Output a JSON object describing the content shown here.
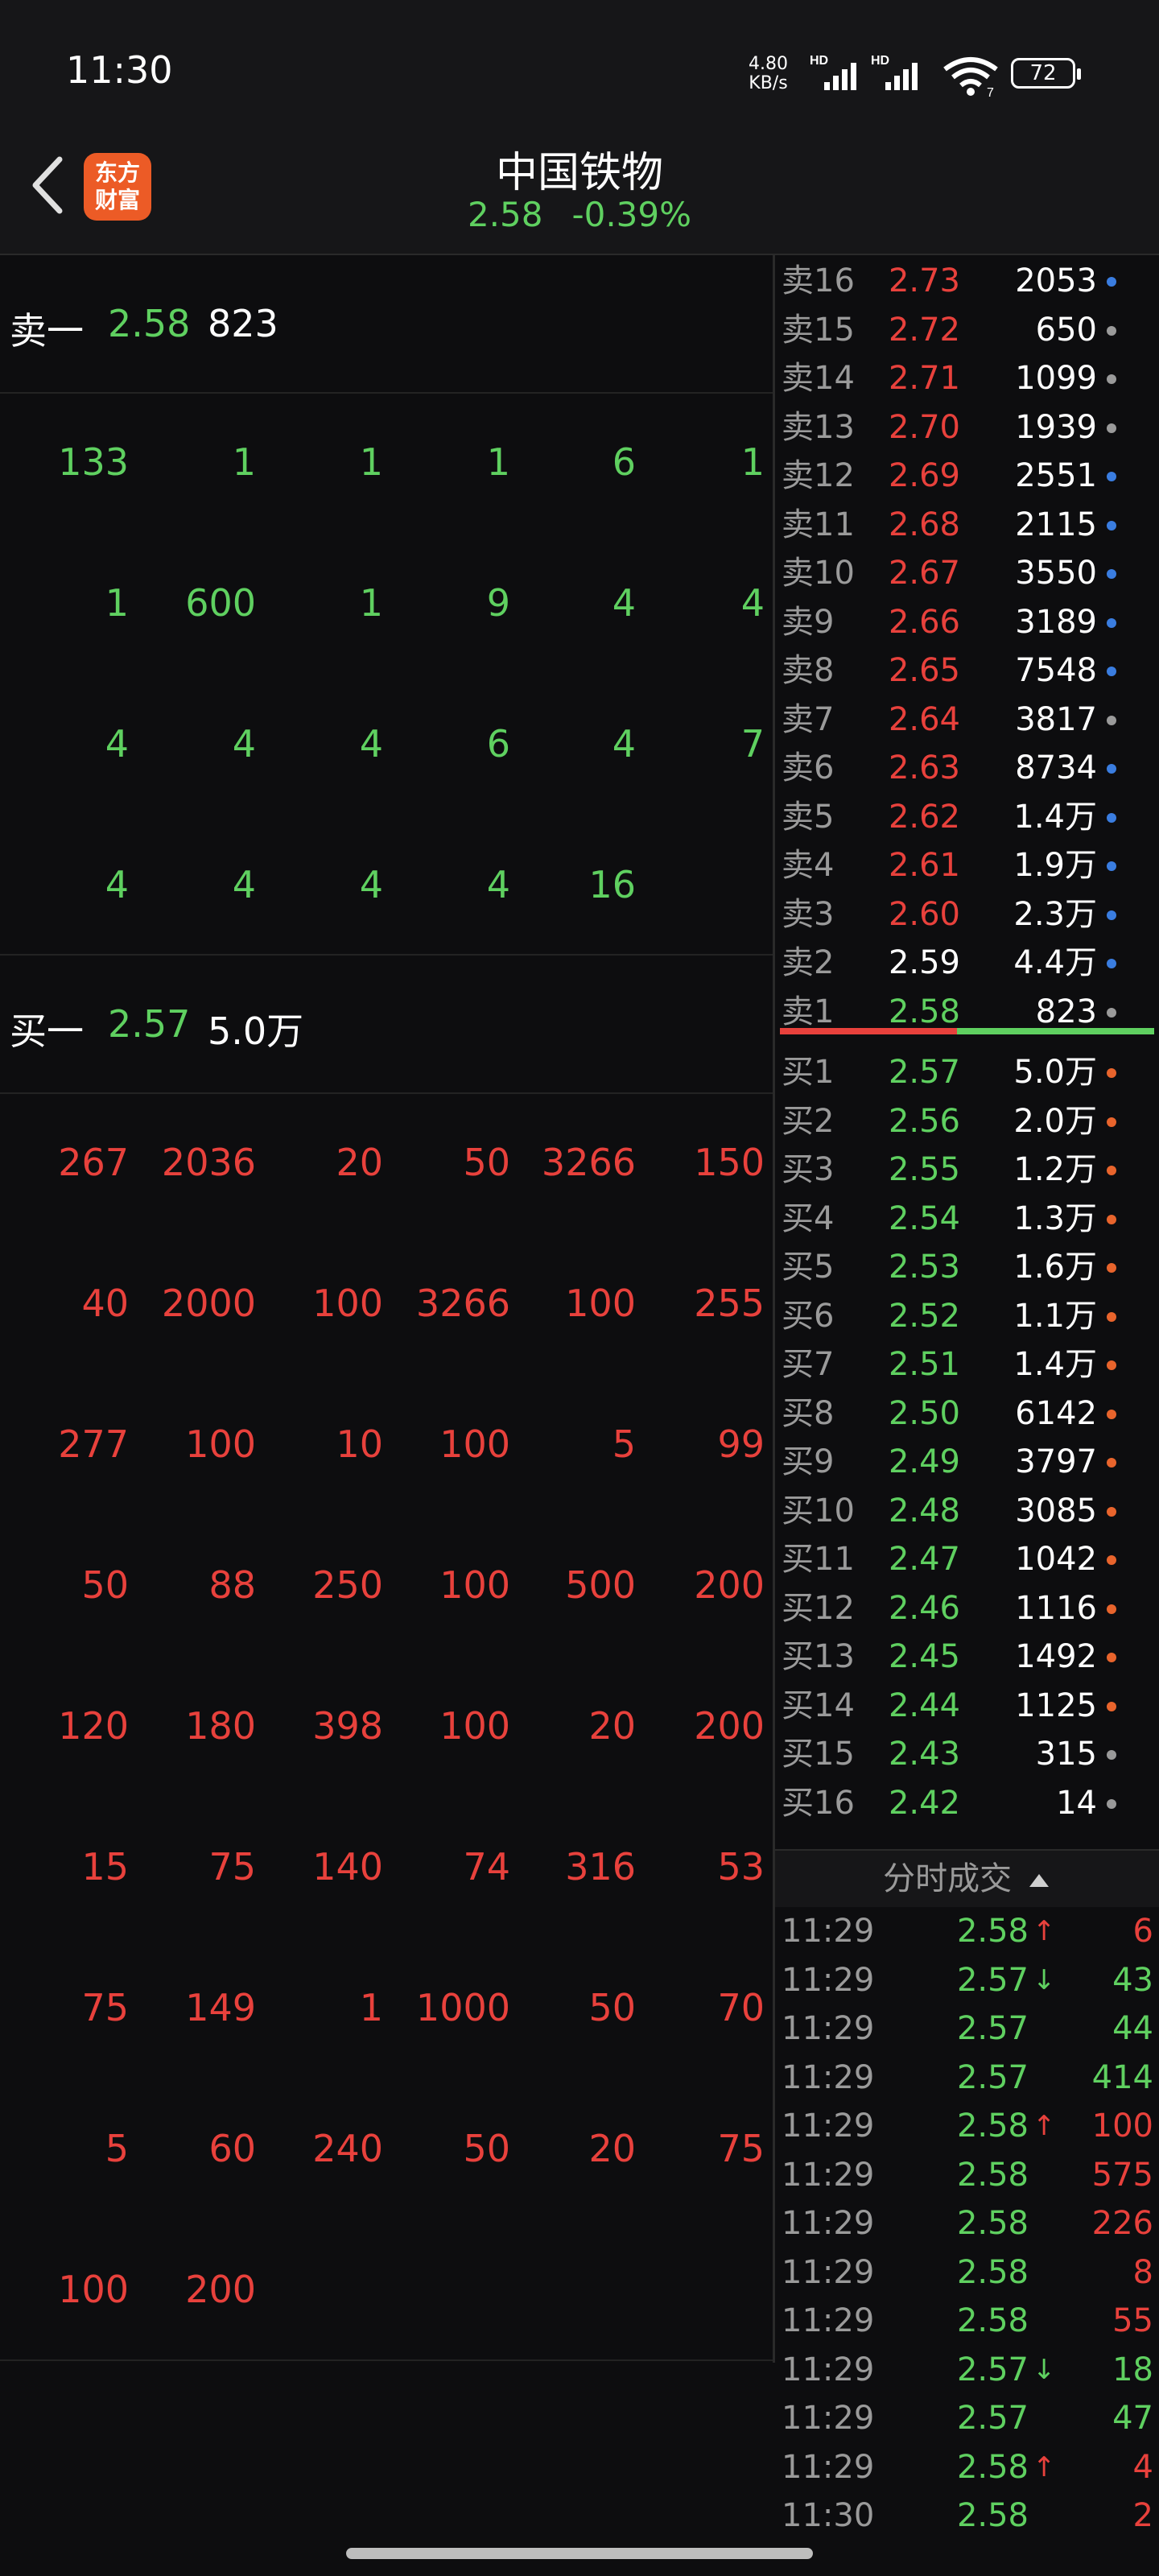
{
  "status_bar": {
    "time": "11:30",
    "net_speed_value": "4.80",
    "net_speed_unit": "KB/s",
    "sig1": "HD",
    "sig2": "HD",
    "wifi_sub": "7",
    "battery": "72"
  },
  "header": {
    "title": "中国铁物",
    "price": "2.58",
    "change": "-0.39%",
    "logo_line1": "东方",
    "logo_line2": "财富"
  },
  "sell_best": {
    "label": "卖一",
    "price": "2.58",
    "volume": "823"
  },
  "sell_queue": [
    [
      "133",
      "1",
      "1",
      "1",
      "6",
      "1"
    ],
    [
      "1",
      "600",
      "1",
      "9",
      "4",
      "4"
    ],
    [
      "4",
      "4",
      "4",
      "6",
      "4",
      "7"
    ],
    [
      "4",
      "4",
      "4",
      "4",
      "16",
      ""
    ]
  ],
  "buy_best": {
    "label": "买一",
    "price": "2.57",
    "volume": "5.0万"
  },
  "buy_queue": [
    [
      "267",
      "2036",
      "20",
      "50",
      "3266",
      "150"
    ],
    [
      "40",
      "2000",
      "100",
      "3266",
      "100",
      "255"
    ],
    [
      "277",
      "100",
      "10",
      "100",
      "5",
      "99"
    ],
    [
      "50",
      "88",
      "250",
      "100",
      "500",
      "200"
    ],
    [
      "120",
      "180",
      "398",
      "100",
      "20",
      "200"
    ],
    [
      "15",
      "75",
      "140",
      "74",
      "316",
      "53"
    ],
    [
      "75",
      "149",
      "1",
      "1000",
      "50",
      "70"
    ],
    [
      "5",
      "60",
      "240",
      "50",
      "20",
      "75"
    ],
    [
      "100",
      "200",
      "",
      "",
      "",
      ""
    ]
  ],
  "sell_levels": [
    {
      "label": "卖16",
      "price": "2.73",
      "vol": "2053",
      "dot": "#3a7de0",
      "pcolor": "#e8413c"
    },
    {
      "label": "卖15",
      "price": "2.72",
      "vol": "650",
      "dot": "#9a9a9a",
      "pcolor": "#e8413c"
    },
    {
      "label": "卖14",
      "price": "2.71",
      "vol": "1099",
      "dot": "#9a9a9a",
      "pcolor": "#e8413c"
    },
    {
      "label": "卖13",
      "price": "2.70",
      "vol": "1939",
      "dot": "#9a9a9a",
      "pcolor": "#e8413c"
    },
    {
      "label": "卖12",
      "price": "2.69",
      "vol": "2551",
      "dot": "#3a7de0",
      "pcolor": "#e8413c"
    },
    {
      "label": "卖11",
      "price": "2.68",
      "vol": "2115",
      "dot": "#3a7de0",
      "pcolor": "#e8413c"
    },
    {
      "label": "卖10",
      "price": "2.67",
      "vol": "3550",
      "dot": "#3a7de0",
      "pcolor": "#e8413c"
    },
    {
      "label": "卖9",
      "price": "2.66",
      "vol": "3189",
      "dot": "#3a7de0",
      "pcolor": "#e8413c"
    },
    {
      "label": "卖8",
      "price": "2.65",
      "vol": "7548",
      "dot": "#3a7de0",
      "pcolor": "#e8413c"
    },
    {
      "label": "卖7",
      "price": "2.64",
      "vol": "3817",
      "dot": "#9a9a9a",
      "pcolor": "#e8413c"
    },
    {
      "label": "卖6",
      "price": "2.63",
      "vol": "8734",
      "dot": "#3a7de0",
      "pcolor": "#e8413c"
    },
    {
      "label": "卖5",
      "price": "2.62",
      "vol": "1.4万",
      "dot": "#3a7de0",
      "pcolor": "#e8413c"
    },
    {
      "label": "卖4",
      "price": "2.61",
      "vol": "1.9万",
      "dot": "#3a7de0",
      "pcolor": "#e8413c"
    },
    {
      "label": "卖3",
      "price": "2.60",
      "vol": "2.3万",
      "dot": "#3a7de0",
      "pcolor": "#e8413c"
    },
    {
      "label": "卖2",
      "price": "2.59",
      "vol": "4.4万",
      "dot": "#3a7de0",
      "pcolor": "#ffffff"
    },
    {
      "label": "卖1",
      "price": "2.58",
      "vol": "823",
      "dot": "#9a9a9a",
      "pcolor": "#5fd060"
    }
  ],
  "buy_levels": [
    {
      "label": "买1",
      "price": "2.57",
      "vol": "5.0万",
      "dot": "#e8642c"
    },
    {
      "label": "买2",
      "price": "2.56",
      "vol": "2.0万",
      "dot": "#e8642c"
    },
    {
      "label": "买3",
      "price": "2.55",
      "vol": "1.2万",
      "dot": "#e8642c"
    },
    {
      "label": "买4",
      "price": "2.54",
      "vol": "1.3万",
      "dot": "#e8642c"
    },
    {
      "label": "买5",
      "price": "2.53",
      "vol": "1.6万",
      "dot": "#e8642c"
    },
    {
      "label": "买6",
      "price": "2.52",
      "vol": "1.1万",
      "dot": "#e8642c"
    },
    {
      "label": "买7",
      "price": "2.51",
      "vol": "1.4万",
      "dot": "#e8642c"
    },
    {
      "label": "买8",
      "price": "2.50",
      "vol": "6142",
      "dot": "#e8642c"
    },
    {
      "label": "买9",
      "price": "2.49",
      "vol": "3797",
      "dot": "#e8642c"
    },
    {
      "label": "买10",
      "price": "2.48",
      "vol": "3085",
      "dot": "#e8642c"
    },
    {
      "label": "买11",
      "price": "2.47",
      "vol": "1042",
      "dot": "#e8642c"
    },
    {
      "label": "买12",
      "price": "2.46",
      "vol": "1116",
      "dot": "#e8642c"
    },
    {
      "label": "买13",
      "price": "2.45",
      "vol": "1492",
      "dot": "#e8642c"
    },
    {
      "label": "买14",
      "price": "2.44",
      "vol": "1125",
      "dot": "#e8642c"
    },
    {
      "label": "买15",
      "price": "2.43",
      "vol": "315",
      "dot": "#9a9a9a"
    },
    {
      "label": "买16",
      "price": "2.42",
      "vol": "14",
      "dot": "#9a9a9a"
    }
  ],
  "trades_title": "分时成交",
  "trades_toggle_icon": "triangle-up",
  "trades": [
    {
      "time": "11:29",
      "price": "2.58",
      "arrow": "↑",
      "vol": "6",
      "vcolor": "#e8413c"
    },
    {
      "time": "11:29",
      "price": "2.57",
      "arrow": "↓",
      "vol": "43",
      "vcolor": "#5fd060"
    },
    {
      "time": "11:29",
      "price": "2.57",
      "arrow": "",
      "vol": "44",
      "vcolor": "#5fd060"
    },
    {
      "time": "11:29",
      "price": "2.57",
      "arrow": "",
      "vol": "414",
      "vcolor": "#5fd060"
    },
    {
      "time": "11:29",
      "price": "2.58",
      "arrow": "↑",
      "vol": "100",
      "vcolor": "#e8413c"
    },
    {
      "time": "11:29",
      "price": "2.58",
      "arrow": "",
      "vol": "575",
      "vcolor": "#e8413c"
    },
    {
      "time": "11:29",
      "price": "2.58",
      "arrow": "",
      "vol": "226",
      "vcolor": "#e8413c"
    },
    {
      "time": "11:29",
      "price": "2.58",
      "arrow": "",
      "vol": "8",
      "vcolor": "#e8413c"
    },
    {
      "time": "11:29",
      "price": "2.58",
      "arrow": "",
      "vol": "55",
      "vcolor": "#e8413c"
    },
    {
      "time": "11:29",
      "price": "2.57",
      "arrow": "↓",
      "vol": "18",
      "vcolor": "#5fd060"
    },
    {
      "time": "11:29",
      "price": "2.57",
      "arrow": "",
      "vol": "47",
      "vcolor": "#5fd060"
    },
    {
      "time": "11:29",
      "price": "2.58",
      "arrow": "↑",
      "vol": "4",
      "vcolor": "#e8413c"
    },
    {
      "time": "11:30",
      "price": "2.58",
      "arrow": "",
      "vol": "2",
      "vcolor": "#e8413c"
    }
  ]
}
